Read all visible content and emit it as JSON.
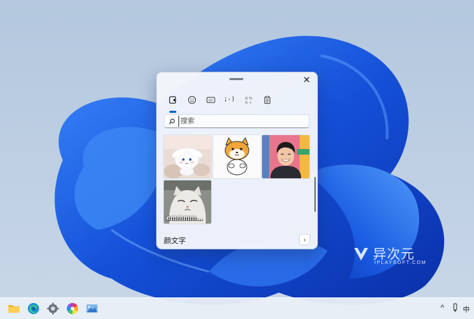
{
  "emoji_panel": {
    "tabs": [
      {
        "name": "recent",
        "icon": "heart-clock-icon",
        "active": true
      },
      {
        "name": "emoji",
        "icon": "smiley-icon",
        "active": false
      },
      {
        "name": "gif",
        "icon": "gif-icon",
        "active": false,
        "label": "GIF"
      },
      {
        "name": "kaomoji",
        "icon": "kaomoji-icon",
        "active": false,
        "label": ";-)"
      },
      {
        "name": "symbols",
        "icon": "symbols-icon",
        "active": false
      },
      {
        "name": "clipboard",
        "icon": "clipboard-icon",
        "active": false
      }
    ],
    "search": {
      "placeholder": "搜索",
      "value": ""
    },
    "gifs": [
      {
        "subject": "cinnamoroll-sticker"
      },
      {
        "subject": "shiba-dog-sticker"
      },
      {
        "subject": "smiling-man-photo"
      },
      {
        "subject": "cat-face-photo",
        "caption": "emmmm..."
      }
    ],
    "footer": {
      "label": "颜文字"
    }
  },
  "watermark": {
    "cn": "异次元",
    "en": "IPLAYSOFT.COM"
  },
  "taskbar": {
    "apps": [
      "file-explorer-icon",
      "edge-icon",
      "settings-gear-icon",
      "color-wheel-icon",
      "photos-icon"
    ],
    "tray": {
      "chevron": "^",
      "ime": "中"
    }
  },
  "colors": {
    "accent": "#0067c0",
    "wallpaper_bloom": "#1a5ee0",
    "taskbar": "#e8eef6"
  }
}
